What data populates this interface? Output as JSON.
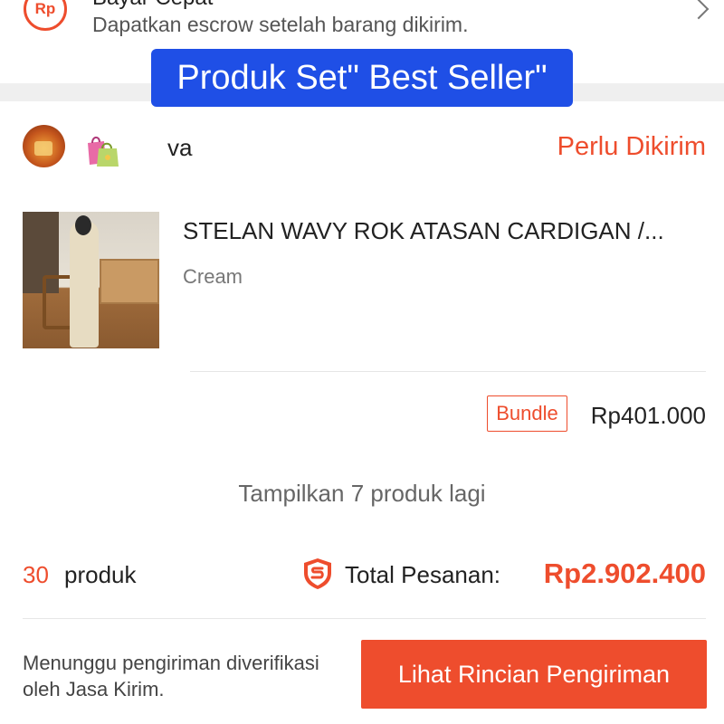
{
  "banner": {
    "title": "Bayar Cepat",
    "subtitle": "Dapatkan escrow setelah barang dikirim.",
    "icon": "rp-icon",
    "chevron_icon": "chevron-right-icon"
  },
  "overlay": {
    "label": "Produk Set\" Best Seller\""
  },
  "shop": {
    "name": "va",
    "status": "Perlu Dikirim",
    "bags_icon": "shopping-bags-icon"
  },
  "product": {
    "name": "STELAN WAVY ROK ATASAN CARDIGAN /...",
    "variant": "Cream",
    "badge": "Bundle",
    "price": "Rp401.000"
  },
  "more_products": "Tampilkan 7 produk lagi",
  "summary": {
    "count": "30",
    "count_label": "produk",
    "total_label": "Total Pesanan:",
    "total_value": "Rp2.902.400",
    "shield_icon": "shield-icon"
  },
  "footer": {
    "note": "Menunggu pengiriman diverifikasi oleh Jasa Kirim.",
    "button_label": "Lihat Rincian Pengiriman"
  },
  "colors": {
    "accent": "#ee4d2d",
    "overlay_bg": "#1f4fe6"
  }
}
